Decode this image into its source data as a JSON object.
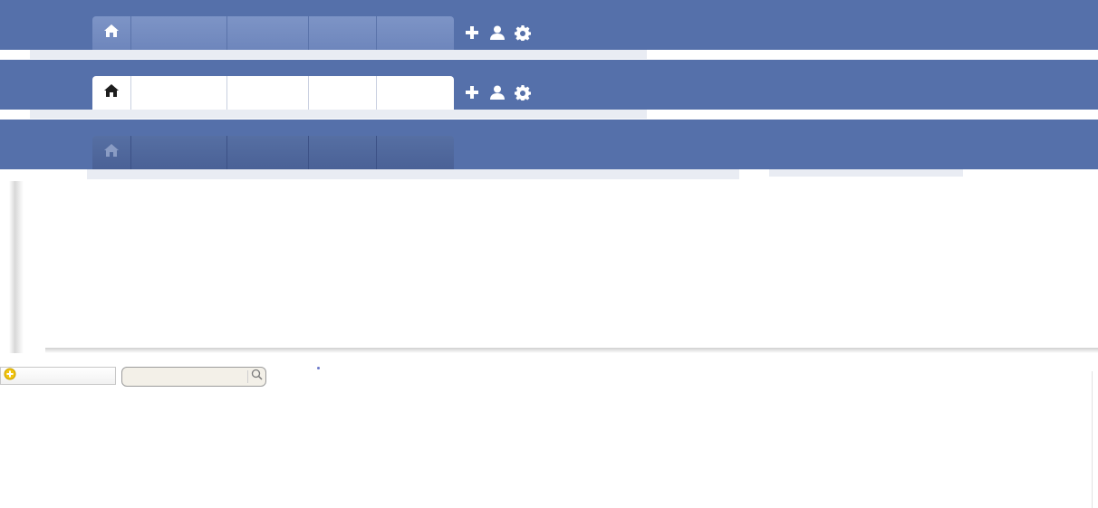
{
  "colors": {
    "bar_blue": "#5570aa",
    "tab_normal": "#7d94c6",
    "tab_active": "#ffffff",
    "tab_dark": "#4a6196",
    "add_icon": "#e3b500"
  },
  "navbars": [
    {
      "state": "normal",
      "tabs": [
        "home-icon",
        "",
        "",
        "",
        ""
      ],
      "actions": [
        "plus-icon",
        "user-icon",
        "gear-icon"
      ]
    },
    {
      "state": "active",
      "tabs": [
        "home-icon",
        "",
        "",
        "",
        ""
      ],
      "actions": [
        "plus-icon",
        "user-icon",
        "gear-icon"
      ]
    },
    {
      "state": "dark",
      "tabs": [
        "home-icon",
        "",
        "",
        "",
        ""
      ],
      "actions": []
    }
  ],
  "add_field": {
    "icon": "plus-circle-icon",
    "value": ""
  },
  "search": {
    "value": "",
    "placeholder": "",
    "icon": "magnifier-icon"
  }
}
